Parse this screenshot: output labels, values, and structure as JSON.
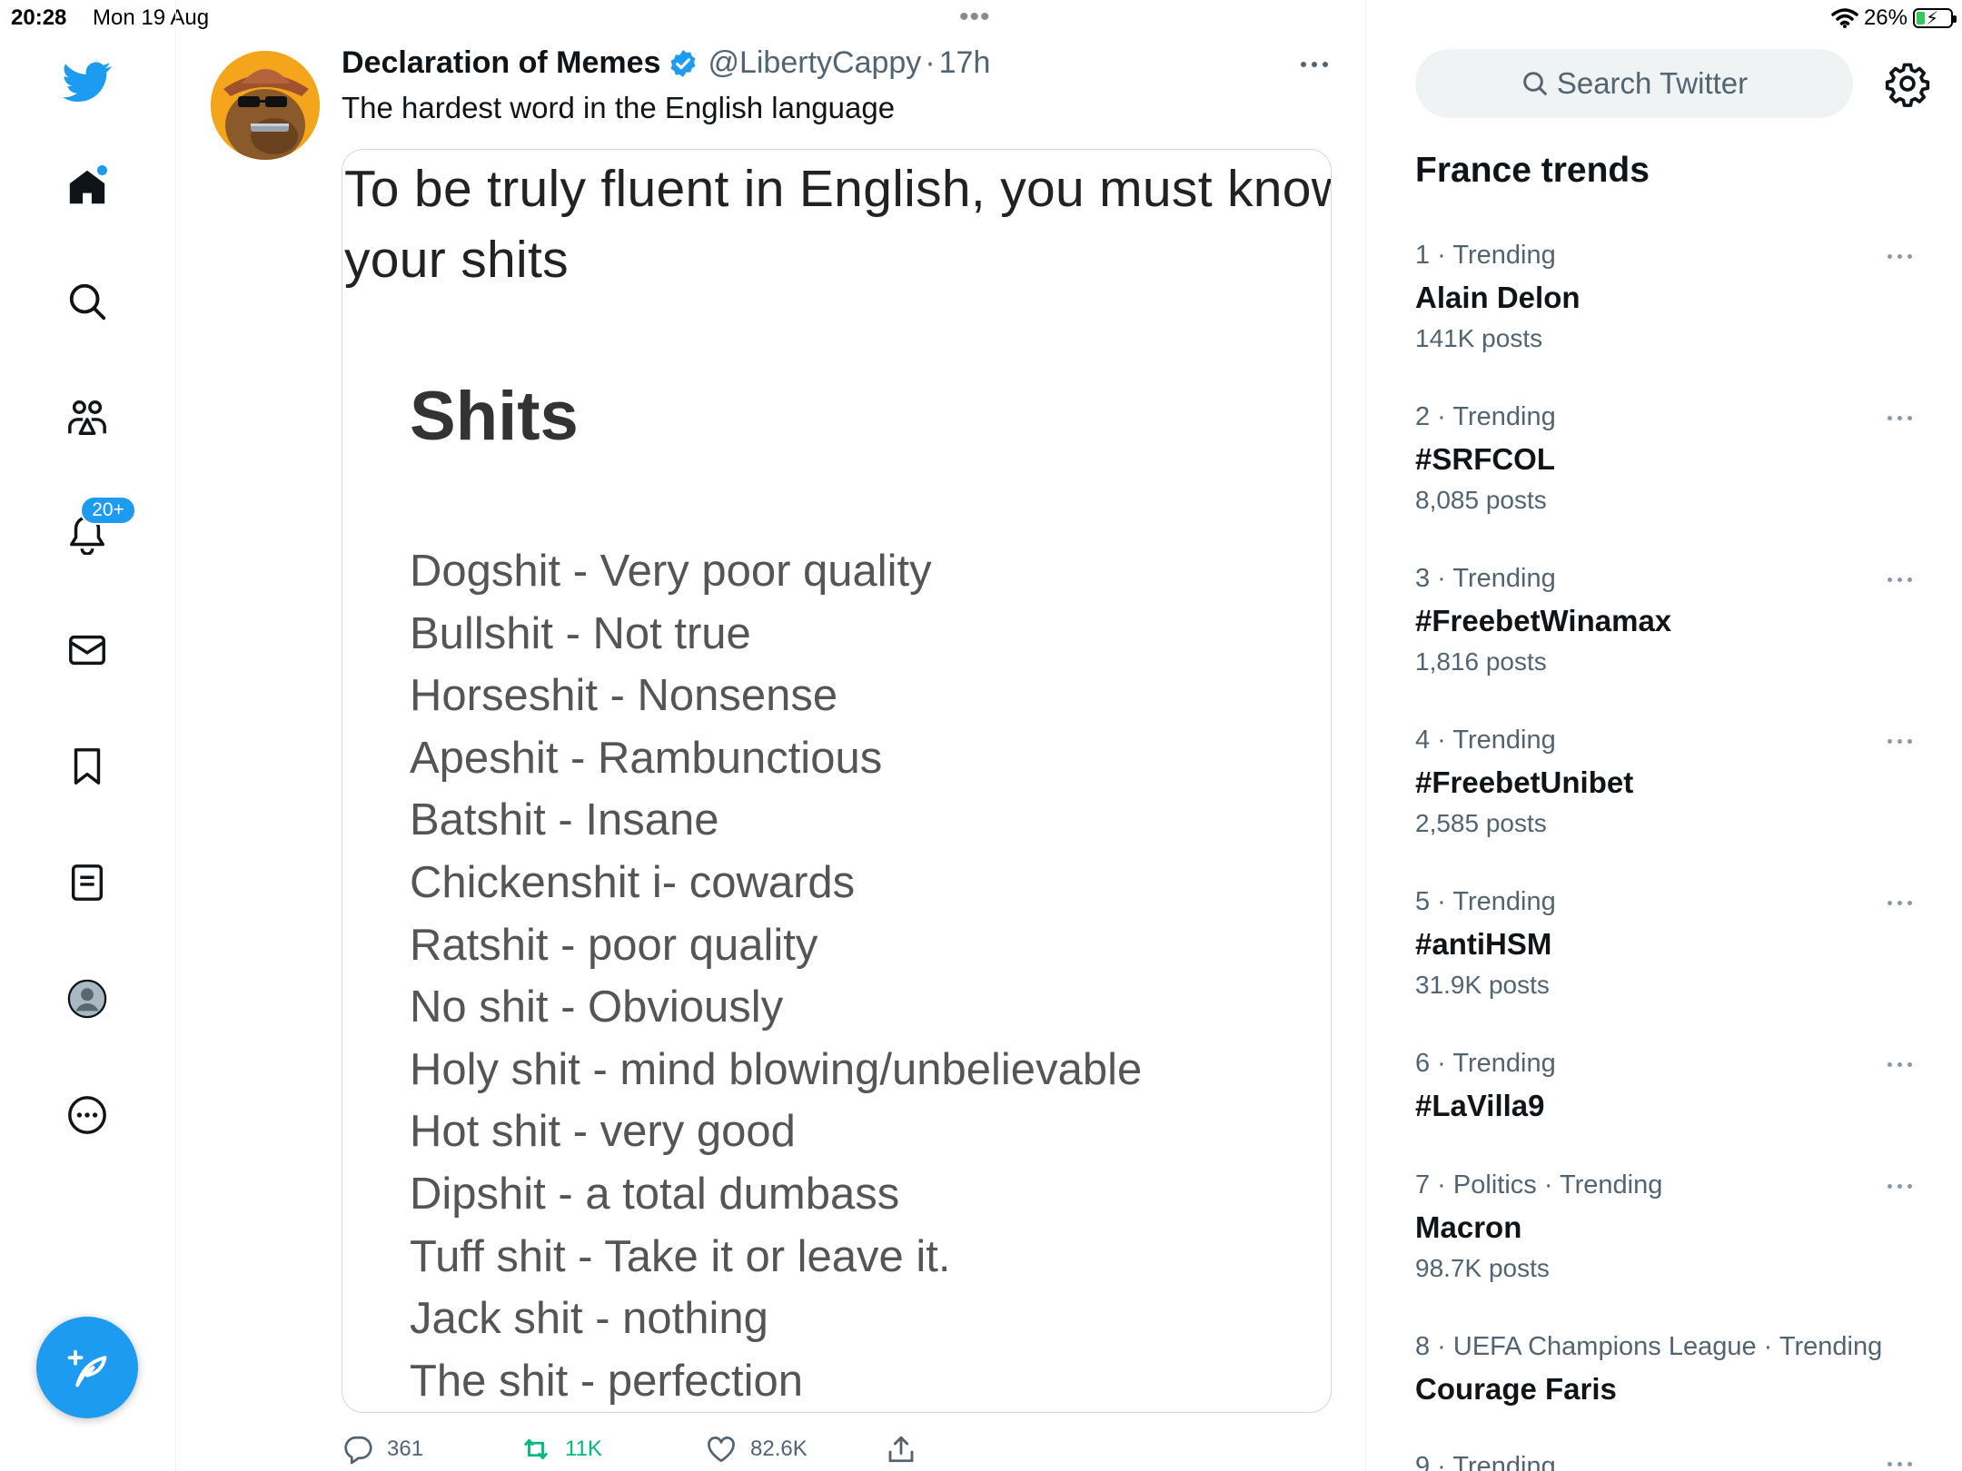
{
  "status_bar": {
    "time": "20:28",
    "date": "Mon 19 Aug",
    "battery_percent": "26%",
    "battery_level": 0.26,
    "charging": true
  },
  "nav": {
    "items": [
      "twitter-logo",
      "home",
      "explore",
      "communities",
      "notifications",
      "messages",
      "bookmarks",
      "lists",
      "profile",
      "more"
    ],
    "notifications_badge": "20+",
    "home_has_new": true
  },
  "tweet": {
    "author_name": "Declaration of Memes",
    "verified": true,
    "author_handle": "@LibertyCappy",
    "separator": "·",
    "time": "17h",
    "text": "The hardest word in the English language",
    "image": {
      "intro_line1": "To be truly fluent in English, you must know",
      "intro_line2": "your shits",
      "heading": "Shits",
      "items": [
        "Dogshit - Very poor quality",
        "Bullshit - Not true",
        "Horseshit - Nonsense",
        "Apeshit - Rambunctious",
        "Batshit - Insane",
        "Chickenshit i- cowards",
        "Ratshit - poor quality",
        "No shit - Obviously",
        "Holy shit - mind blowing/unbelievable",
        "Hot shit - very good",
        "Dipshit - a total dumbass",
        "Tuff shit - Take it or leave it.",
        "Jack shit - nothing",
        "The shit - perfection"
      ]
    },
    "stats": {
      "replies": "361",
      "retweets": "11K",
      "likes": "82.6K"
    }
  },
  "sidebar": {
    "search_placeholder": "Search Twitter",
    "trends_title": "France trends",
    "trends": [
      {
        "meta": "1 · Trending",
        "name": "Alain Delon",
        "posts": "141K posts"
      },
      {
        "meta": "2 · Trending",
        "name": "#SRFCOL",
        "posts": "8,085 posts"
      },
      {
        "meta": "3 · Trending",
        "name": "#FreebetWinamax",
        "posts": "1,816 posts"
      },
      {
        "meta": "4 · Trending",
        "name": "#FreebetUnibet",
        "posts": "2,585 posts"
      },
      {
        "meta": "5 · Trending",
        "name": "#antiHSM",
        "posts": "31.9K posts"
      },
      {
        "meta": "6 · Trending",
        "name": "#LaVilla9",
        "posts": ""
      },
      {
        "meta": "7 · Politics · Trending",
        "name": "Macron",
        "posts": "98.7K posts"
      },
      {
        "meta": "8 · UEFA Champions League · Trending",
        "name": "Courage Faris",
        "posts": ""
      },
      {
        "meta": "9 · Trending",
        "name": "",
        "posts": ""
      }
    ]
  },
  "colors": {
    "accent": "#1d9bf0",
    "retweet_green": "#00ba7c",
    "text_primary": "#0f1419",
    "text_secondary": "#536471"
  }
}
